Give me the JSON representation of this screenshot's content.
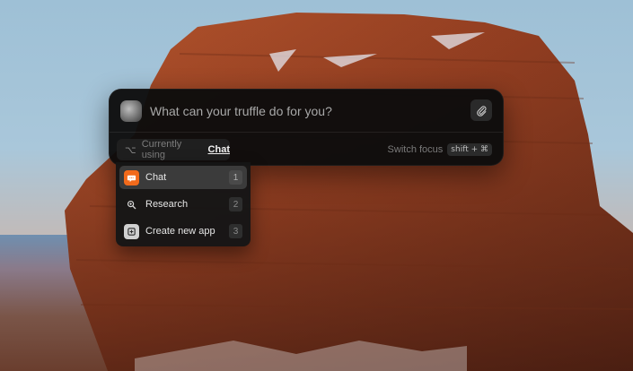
{
  "palette": {
    "prompt_placeholder": "What can your truffle do for you?",
    "mode": {
      "modifier_glyph": "⌥",
      "prefix": "Currently using",
      "current_app": "Chat"
    },
    "switch_focus": {
      "label": "Switch focus",
      "shortcut": "shift + ⌘"
    }
  },
  "dropdown": {
    "items": [
      {
        "label": "Chat",
        "shortcut": "1",
        "icon": "chat-bubble-icon",
        "selected": true,
        "icon_bg": "#f26a1b"
      },
      {
        "label": "Research",
        "shortcut": "2",
        "icon": "magnifier-icon",
        "selected": false
      },
      {
        "label": "Create new app",
        "shortcut": "3",
        "icon": "plus-square-icon",
        "selected": false
      }
    ]
  },
  "colors": {
    "accent": "#f26a1b",
    "panel": "#0c0c0c"
  }
}
